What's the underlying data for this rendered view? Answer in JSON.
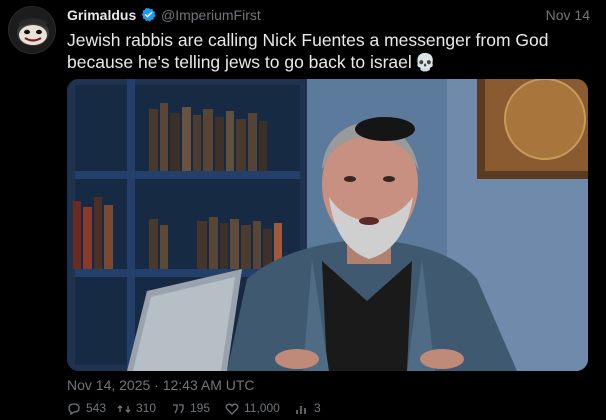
{
  "tweet": {
    "author": {
      "display_name": "Grimaldus",
      "handle": "@ImperiumFirst",
      "verified": true
    },
    "date": "Nov 14",
    "text": "Jewish rabbis are calling Nick Fuentes a messenger from God because he's telling jews to go back to israel",
    "emoji": "💀",
    "timestamp": "Nov 14, 2025 · 12:43 AM UTC",
    "stats": {
      "replies": "543",
      "retweets": "310",
      "quotes": "195",
      "likes": "11,000",
      "views": "3"
    },
    "media_description_icon": "video-frame"
  },
  "colors": {
    "background": "#000000",
    "text": "#e7e9ea",
    "muted": "#71767b",
    "verified": "#1d9bf0"
  },
  "icons": [
    "avatar",
    "verified-badge-icon",
    "reply-icon",
    "retweet-icon",
    "quote-icon",
    "like-icon",
    "views-icon"
  ]
}
